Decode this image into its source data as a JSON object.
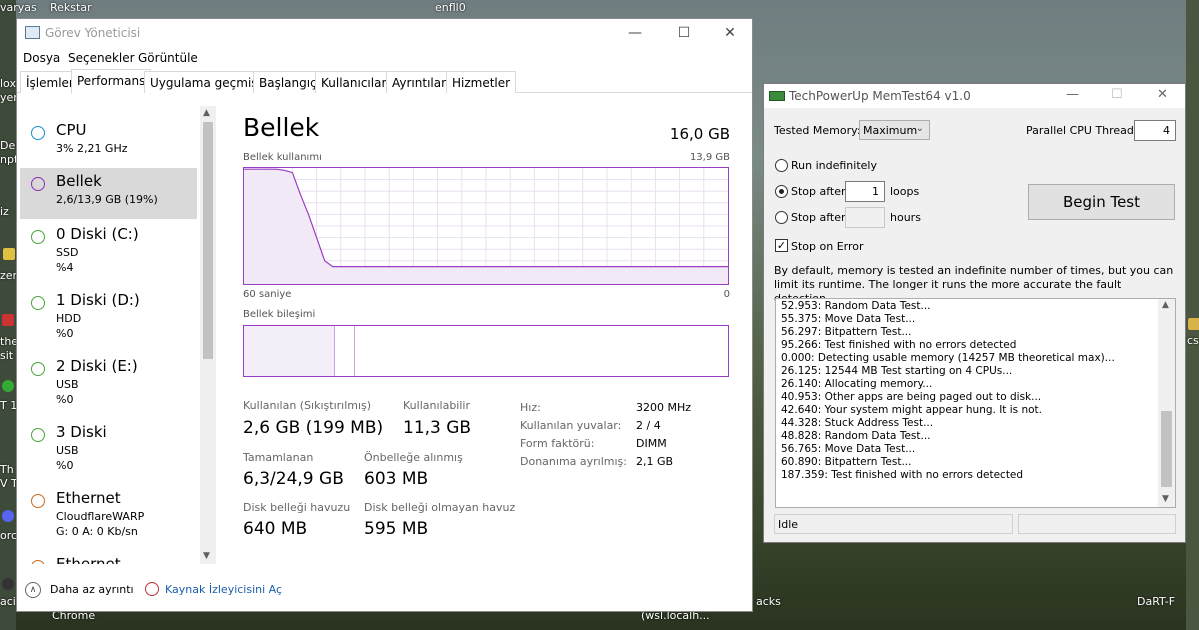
{
  "desktop": {
    "left_labels": [
      "lox",
      "yer",
      "Dea",
      "npt",
      "iz",
      "zen",
      "the",
      "sit",
      "T 1",
      "Th",
      "V T",
      "orc",
      "aci"
    ],
    "bottom_labels": [
      "Chrome",
      "(wsl.localh...",
      "acks",
      "DaRT-F"
    ],
    "top_labels": [
      "varyas",
      "Rekstar",
      "enfll0"
    ],
    "right_labels": [
      "cs"
    ]
  },
  "task_manager": {
    "title": "Görev Yöneticisi",
    "minimize": "—",
    "maximize": "☐",
    "close": "✕",
    "menu": [
      "Dosya",
      "Seçenekler",
      "Görüntüle"
    ],
    "tabs": [
      "İşlemler",
      "Performans",
      "Uygulama geçmişi",
      "Başlangıç",
      "Kullanıcılar",
      "Ayrıntılar",
      "Hizmetler"
    ],
    "sidebar": [
      {
        "name": "CPU",
        "l2": "3%  2,21 GHz",
        "l3": "",
        "l4": "",
        "color": "#1a8fc7"
      },
      {
        "name": "Bellek",
        "l2": "2,6/13,9 GB (19%)",
        "l3": "",
        "l4": "",
        "color": "#8b2fb4"
      },
      {
        "name": "0 Diski (C:)",
        "l2": "SSD",
        "l3": "%4",
        "l4": "",
        "color": "#4aa33c"
      },
      {
        "name": "1 Diski (D:)",
        "l2": "HDD",
        "l3": "%0",
        "l4": "",
        "color": "#4aa33c"
      },
      {
        "name": "2 Diski (E:)",
        "l2": "USB",
        "l3": "%0",
        "l4": "",
        "color": "#4aa33c"
      },
      {
        "name": "3 Diski",
        "l2": "USB",
        "l3": "%0",
        "l4": "",
        "color": "#4aa33c"
      },
      {
        "name": "Ethernet",
        "l2": "CloudflareWARP",
        "l3": "G: 0  A: 0 Kb/sn",
        "l4": "",
        "color": "#c96a1e"
      },
      {
        "name": "Ethernet",
        "l2": "",
        "l3": "",
        "l4": "",
        "color": "#c96a1e"
      }
    ],
    "main": {
      "title": "Bellek",
      "total": "16,0 GB",
      "usage_label": "Bellek kullanımı",
      "usage_max": "13,9 GB",
      "axis_left": "60 saniye",
      "axis_right": "0",
      "composition_label": "Bellek bileşimi",
      "usage_series_pct": [
        99,
        99,
        99,
        99,
        99,
        98,
        96,
        77,
        60,
        40,
        20,
        15,
        15,
        15,
        15,
        15,
        15,
        15,
        15,
        15,
        15,
        15,
        15,
        15,
        15,
        15,
        15,
        15,
        15,
        15,
        15,
        15,
        15,
        15,
        15,
        15,
        15,
        15,
        15,
        15,
        15,
        15,
        15,
        15,
        15,
        15,
        15,
        15,
        15,
        15,
        15,
        15,
        15,
        15,
        15,
        15,
        15,
        15,
        15,
        15,
        15
      ],
      "stats": {
        "in_use_label": "Kullanılan (Sıkıştırılmış)",
        "in_use_value": "2,6 GB (199 MB)",
        "available_label": "Kullanılabilir",
        "available_value": "11,3 GB",
        "committed_label": "Tamamlanan",
        "committed_value": "6,3/24,9 GB",
        "cached_label": "Önbelleğe alınmış",
        "cached_value": "603 MB",
        "paged_label": "Disk belleği havuzu",
        "paged_value": "640 MB",
        "nonpaged_label": "Disk belleği olmayan havuz",
        "nonpaged_value": "595 MB"
      },
      "details": [
        {
          "k": "Hız:",
          "v": "3200 MHz"
        },
        {
          "k": "Kullanılan yuvalar:",
          "v": "2 / 4"
        },
        {
          "k": "Form faktörü:",
          "v": "DIMM"
        },
        {
          "k": "Donanıma ayrılmış:",
          "v": "2,1 GB"
        }
      ]
    },
    "footer": {
      "fewer_details": "Daha az ayrıntı",
      "resource_monitor": "Kaynak İzleyicisini Aç",
      "up_glyph": "∧"
    }
  },
  "memtest": {
    "title": "TechPowerUp MemTest64 v1.0",
    "minimize": "—",
    "maximize": "☐",
    "close": "✕",
    "tested_memory_label": "Tested Memory:",
    "tested_memory_value": "Maximum",
    "threads_label": "Parallel CPU Threads:",
    "threads_value": "4",
    "run_indef": "Run indefinitely",
    "stop_after": "Stop after",
    "loops_value": "1",
    "loops_label": "loops",
    "stop_after_hours": "Stop after",
    "hours_label": "hours",
    "stop_on_error": "Stop on Error",
    "begin_test": "Begin Test",
    "description": "By default, memory is tested an indefinite number of times, but you can limit its runtime. The longer it runs the more accurate the fault detection.",
    "log": [
      "52.953: Random Data Test...",
      "55.375: Move Data Test...",
      "56.297: Bitpattern Test...",
      "95.266: Test finished with no errors detected",
      "0.000: Detecting usable memory (14257 MB theoretical max)...",
      "26.125: 12544 MB Test starting on 4 CPUs...",
      "26.140: Allocating memory...",
      "40.953: Other apps are being paged out to disk...",
      "42.640: Your system might appear hung. It is not.",
      "44.328: Stuck Address Test...",
      "48.828: Random Data Test...",
      "56.765: Move Data Test...",
      "60.890: Bitpattern Test...",
      "187.359: Test finished with no errors detected"
    ],
    "status": "Idle",
    "check_glyph": "✓",
    "dropdown_glyph": "⌄"
  }
}
